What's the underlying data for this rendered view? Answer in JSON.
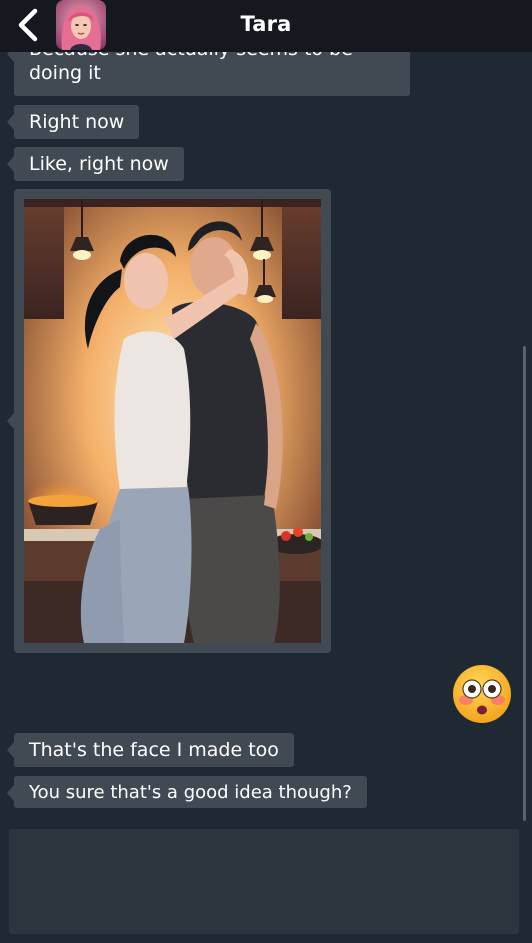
{
  "header": {
    "title": "Tara",
    "back_icon": "chevron-left-icon"
  },
  "messages": [
    {
      "sender": "Tara",
      "type": "text",
      "text": "Because she actually seems to be doing it"
    },
    {
      "sender": "Tara",
      "type": "text",
      "text": "Right now"
    },
    {
      "sender": "Tara",
      "type": "text",
      "text": "Like, right now"
    },
    {
      "sender": "Tara",
      "type": "image"
    },
    {
      "sender": "me",
      "type": "emoji",
      "emoji": "flushed-face-icon"
    },
    {
      "sender": "Tara",
      "type": "text",
      "text": "That's the face I made too"
    },
    {
      "sender": "Tara",
      "type": "text",
      "text": "You sure that's a good idea though?"
    }
  ],
  "composer": {
    "placeholder": ""
  },
  "colors": {
    "background": "#1f2934",
    "header": "#15191f",
    "bubble": "#414a53",
    "composer": "#2c343e"
  }
}
